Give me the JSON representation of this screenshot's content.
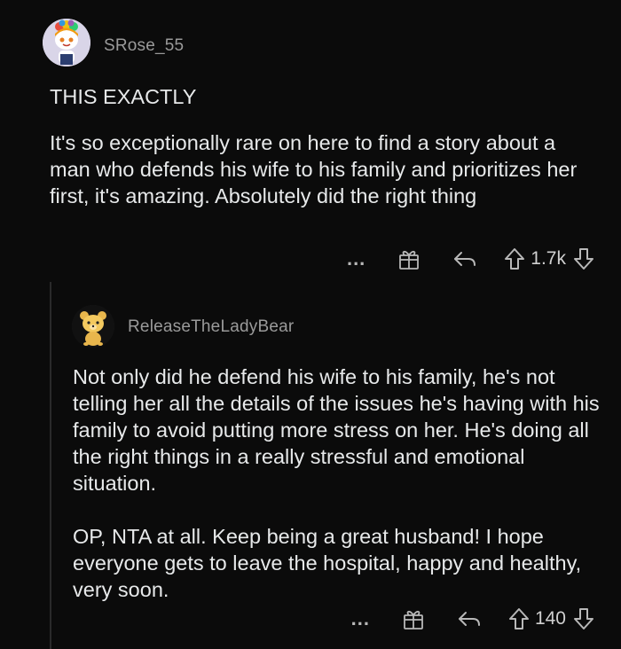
{
  "comments": [
    {
      "username": "SRose_55",
      "title": "THIS EXACTLY",
      "body": "It's so exceptionally rare on here to find a story about a man who defends his wife to his family and prioritizes her first, it's amazing.  Absolutely did the right thing",
      "more_label": "...",
      "vote_count": "1.7k",
      "avatar_icon": "snoo-avatar-icon",
      "accent": "#d8d4e6"
    },
    {
      "username": "ReleaseTheLadyBear",
      "paragraphs": [
        "Not only did he defend his wife to his family, he's not telling her all the details of the issues he's having with his family to avoid putting more stress on her. He's doing all the right things in a really stressful and emotional situation.",
        "OP, NTA at all. Keep being a great husband! I hope everyone gets to leave the hospital, happy and healthy, very soon."
      ],
      "more_label": "...",
      "vote_count": "140",
      "avatar_icon": "bear-avatar-icon"
    }
  ],
  "colors": {
    "background": "#0b0b0b",
    "text": "#e7e9ea",
    "muted": "#9a9a9a",
    "icon": "#b8b8b8"
  }
}
